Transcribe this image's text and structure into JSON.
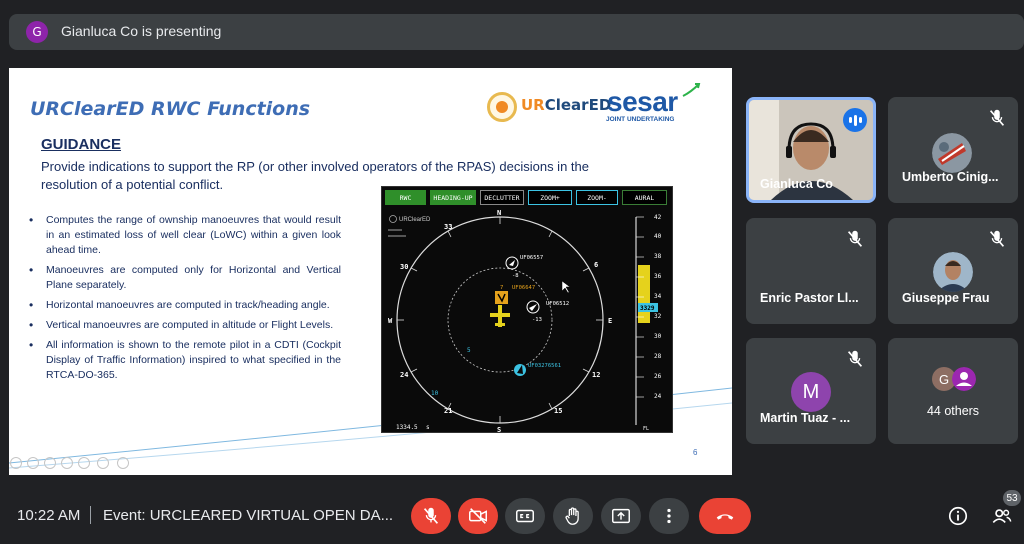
{
  "presenting": {
    "avatar_letter": "G",
    "text": "Gianluca Co is presenting"
  },
  "slide": {
    "title": "URClearED RWC Functions",
    "logo_text_prefix": "UR",
    "logo_text_suffix": "ClearED",
    "sesar_text": "sesar",
    "sesar_sub": "JOINT UNDERTAKING",
    "heading": "GUIDANCE",
    "intro": "Provide indications to support the RP (or other involved operators of the RPAS) decisions in the resolution of a potential conflict.",
    "bullets": [
      "Computes the range of ownship manoeuvres that would result in an estimated loss of well clear (LoWC) within a given look ahead time.",
      "Manoeuvres are computed only for Horizontal and Vertical Plane separately.",
      "Horizontal manoeuvres are computed in track/heading angle.",
      "Vertical manoeuvres are computed in altitude or Flight Levels.",
      "All information is shown to the remote pilot in a CDTI (Cockpit Display of Traffic Information) inspired to what specified in the RTCA-DO-365."
    ],
    "page_number": "6"
  },
  "radar": {
    "buttons": [
      "RWC",
      "HEADING-UP",
      "DECLUTTER",
      "ZOOM+",
      "ZOOM-",
      "AURAL"
    ],
    "logo": "URClearED",
    "compass": {
      "n": "N",
      "e": "E",
      "s": "S",
      "w": "W",
      "l33": "33",
      "l30": "30",
      "l6": "6",
      "l12": "12",
      "l15": "15",
      "l21": "21",
      "l24": "24",
      "l5": "5",
      "l10": "10"
    },
    "traffic": [
      {
        "id": "UF06557",
        "sub": "-8"
      },
      {
        "id": "UF06647",
        "sub": "7"
      },
      {
        "id": "UF06512",
        "sub": "-13"
      },
      {
        "id": "UF03276561",
        "sub": ""
      }
    ],
    "alt_ticks": [
      "42",
      "40",
      "38",
      "36",
      "34",
      "32",
      "30",
      "28",
      "26",
      "24"
    ],
    "alt_current": "3329",
    "alt_unit": "FL",
    "range": "1334.5",
    "range_unit": "s"
  },
  "participants": [
    {
      "name": "Gianluca Co",
      "video": true,
      "speaking": true
    },
    {
      "name": "Umberto Cinig...",
      "muted": true
    },
    {
      "name": "Enric Pastor Ll...",
      "muted": true
    },
    {
      "name": "Giuseppe Frau",
      "muted": true
    },
    {
      "name": "Martin Tuaz - ...",
      "muted": true,
      "avatar_letter": "M",
      "avatar_color": "#8e44ad"
    },
    {
      "name": "44 others",
      "avatar_letter": "G",
      "avatar_color": "#8d6e63"
    }
  ],
  "bottom_bar": {
    "time": "10:22 AM",
    "separator": "|",
    "event": "Event: URCLEARED VIRTUAL OPEN DA...",
    "participant_count": "53"
  },
  "colors": {
    "end_call": "#ea4335",
    "mic_off": "#ea4335",
    "accent": "#8ab4f8",
    "radar_green": "#2f8f2a",
    "radar_cyan": "#3cc3e3",
    "alt_yellow": "#e5d21c"
  }
}
